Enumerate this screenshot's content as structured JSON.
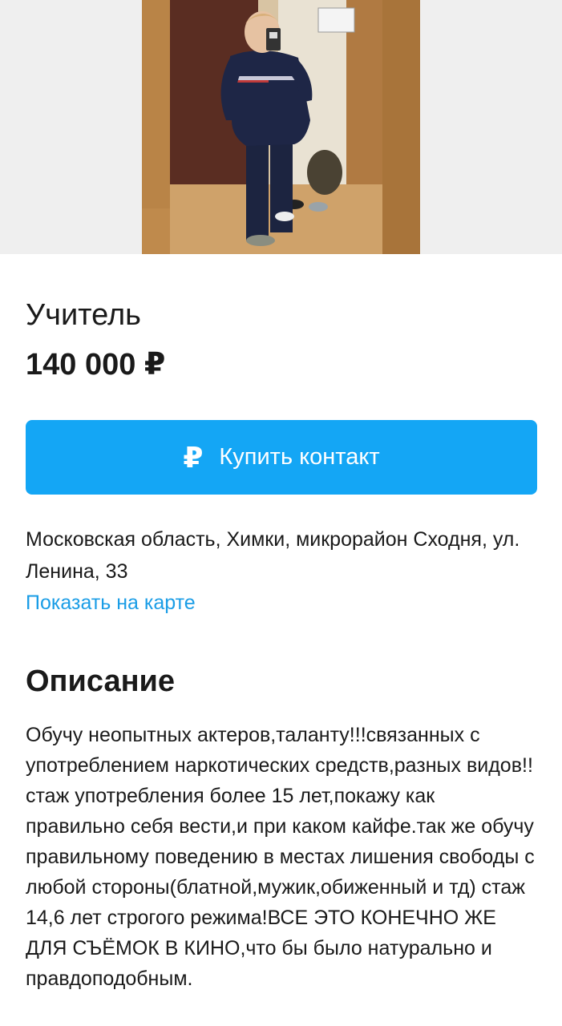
{
  "listing": {
    "title": "Учитель",
    "price": "140 000 ₽",
    "buy_button": {
      "icon": "₽",
      "label": "Купить контакт"
    },
    "address": "Московская область, Химки, микрорайон Сходня, ул. Ленина, 33",
    "map_link": "Показать на карте",
    "description_heading": "Описание",
    "description_text": "Обучу неопытных актеров,таланту!!!связанных с употреблением наркотических средств,разных видов!!стаж употребления более 15 лет,покажу как правильно себя вести,и при каком кайфе.так же обучу правильному поведению в местах лишения свободы с любой стороны(блатной,мужик,обиженный и тд) стаж 14,6 лет строгого режима!ВСЕ ЭТО КОНЕЧНО ЖЕ ДЛЯ СЪЁМОК В КИНО,что бы было натурально и правдоподобным."
  },
  "colors": {
    "accent": "#14a6f5",
    "link": "#1a9de6",
    "photo_background": "#efefef"
  }
}
